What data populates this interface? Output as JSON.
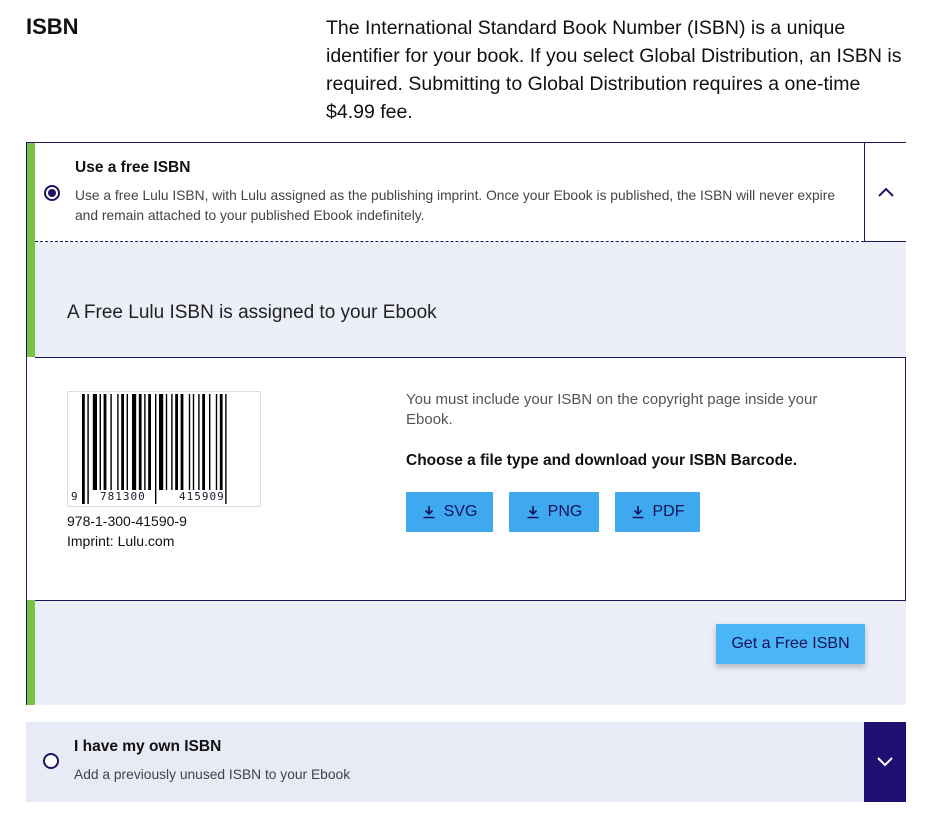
{
  "section": {
    "title": "ISBN",
    "description": "The International Standard Book Number (ISBN) is a unique identifier for your book. If you select Global Distribution, an ISBN is required. Submitting to Global Distribution requires a one-time $4.99 fee."
  },
  "option_free": {
    "title": "Use a free ISBN",
    "subtitle": "Use a free Lulu ISBN, with Lulu assigned as the publishing imprint. Once your Ebook is published, the ISBN will never expire and remain attached to your published Ebook indefinitely.",
    "selected": true,
    "collapse_icon": "chevron-up-icon",
    "assigned_text": "A Free Lulu ISBN is assigned to your Ebook",
    "barcode": {
      "digit_left": "9",
      "digits_mid": "781300",
      "digits_right": "415909"
    },
    "isbn_number": "978-1-300-41590-9",
    "imprint": "Imprint: Lulu.com",
    "instructions": "You must include your ISBN on the copyright page inside your Ebook.",
    "download_prompt": "Choose a file type and download your ISBN Barcode.",
    "download_buttons": [
      {
        "label": "SVG",
        "icon": "download-icon"
      },
      {
        "label": "PNG",
        "icon": "download-icon"
      },
      {
        "label": "PDF",
        "icon": "download-icon"
      }
    ],
    "get_free_button": "Get a Free ISBN"
  },
  "option_own": {
    "title": "I have my own ISBN",
    "subtitle": "Add a previously unused ISBN to your Ebook",
    "selected": false,
    "expand_icon": "chevron-down-icon"
  },
  "colors": {
    "accent_green": "#76c442",
    "navy": "#1d1463",
    "button_blue": "#3fa9f0",
    "panel_bg": "#eceef8"
  }
}
